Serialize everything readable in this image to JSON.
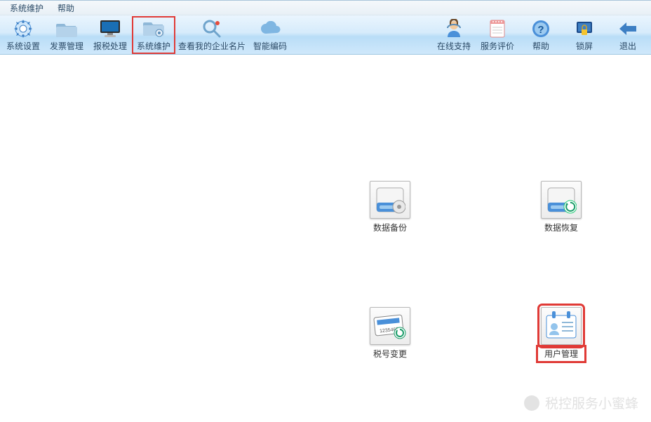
{
  "menubar": {
    "sys_maint": "系统维护",
    "help": "帮助"
  },
  "toolbar": {
    "system_settings": "系统设置",
    "invoice_mgmt": "发票管理",
    "tax_report": "报税处理",
    "sys_maint": "系统维护",
    "view_card": "查看我的企业名片",
    "smart_code": "智能编码",
    "online_support": "在线支持",
    "service_rating": "服务评价",
    "help": "帮助",
    "lock": "锁屏",
    "exit": "退出"
  },
  "content": {
    "data_backup": "数据备份",
    "data_restore": "数据恢复",
    "tax_change": "税号变更",
    "user_mgmt": "用户管理"
  },
  "card": {
    "sample_number": "1235468"
  },
  "footer": {
    "brand": "税控服务小蜜蜂"
  }
}
